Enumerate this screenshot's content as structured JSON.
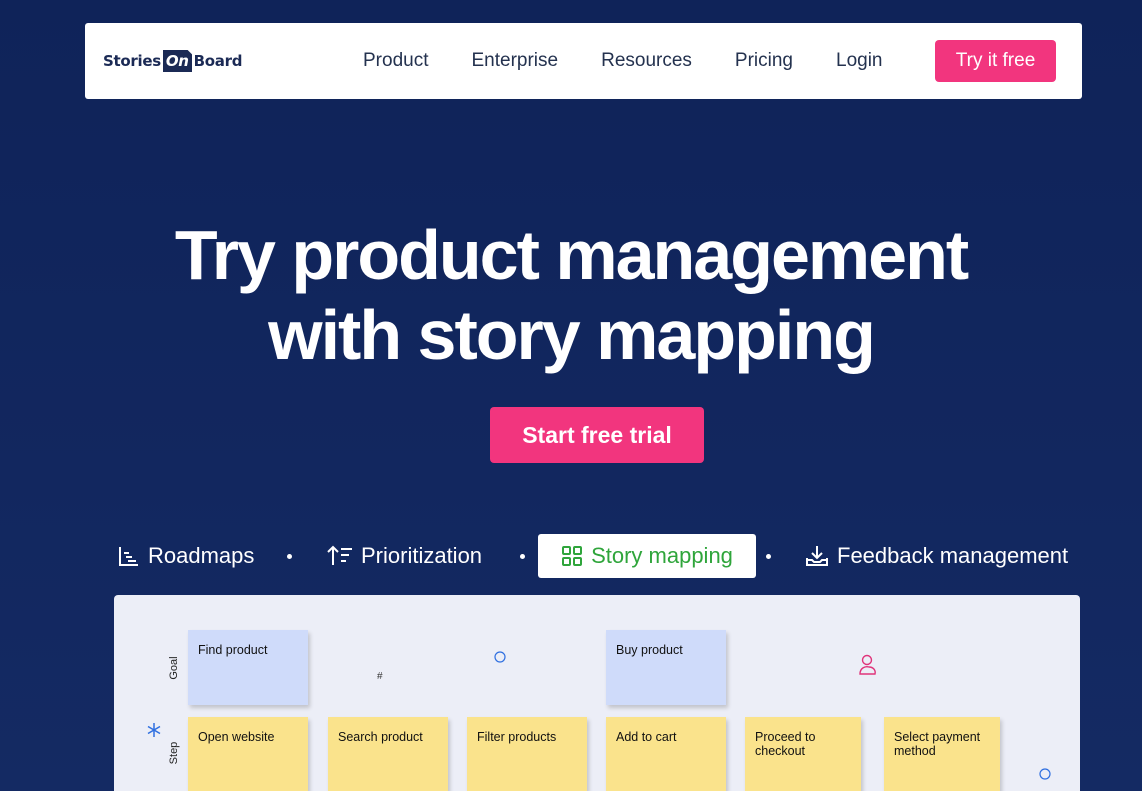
{
  "nav": {
    "logo": {
      "part1": "Stories",
      "part2": "On",
      "part3": "Board"
    },
    "links": [
      "Product",
      "Enterprise",
      "Resources",
      "Pricing",
      "Login"
    ],
    "cta": "Try it free"
  },
  "hero": {
    "title_line1": "Try product management",
    "title_line2": "with story mapping",
    "cta": "Start free trial"
  },
  "tabs": [
    {
      "label": "Roadmaps",
      "icon": "roadmap-icon"
    },
    {
      "label": "Prioritization",
      "icon": "sort-icon"
    },
    {
      "label": "Story mapping",
      "icon": "grid-icon",
      "active": true
    },
    {
      "label": "Feedback management",
      "icon": "inbox-download-icon"
    }
  ],
  "board": {
    "row_labels": {
      "goal": "Goal",
      "step": "Step"
    },
    "goals": [
      "Find product",
      "Buy product"
    ],
    "steps": [
      "Open website",
      "Search product",
      "Filter products",
      "Add to cart",
      "Proceed to checkout",
      "Select payment method"
    ],
    "decor": {
      "hash": "#"
    }
  },
  "colors": {
    "background": "#12275f",
    "accent": "#f2357e",
    "active_tab_text": "#2fa53b",
    "goal_card": "#cfdbfa",
    "step_card": "#fae38c"
  }
}
